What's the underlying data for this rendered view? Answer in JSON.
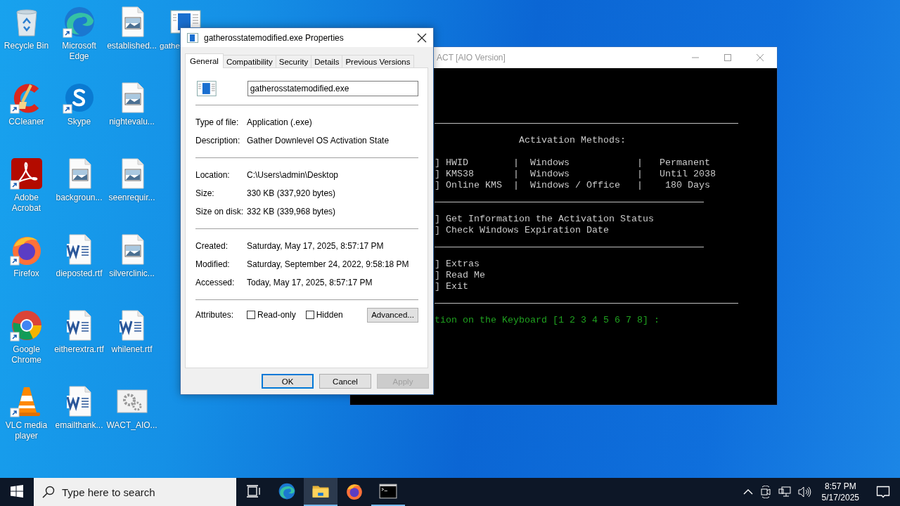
{
  "desktop": {
    "icons": [
      {
        "label": "Recycle Bin",
        "kind": "recycle",
        "shortcut": false
      },
      {
        "label": "CCleaner",
        "kind": "ccleaner",
        "shortcut": true
      },
      {
        "label": "Adobe Acrobat",
        "kind": "acrobat",
        "shortcut": true
      },
      {
        "label": "Firefox",
        "kind": "firefox",
        "shortcut": true
      },
      {
        "label": "Google Chrome",
        "kind": "chrome",
        "shortcut": true
      },
      {
        "label": "VLC media player",
        "kind": "vlc",
        "shortcut": true
      },
      {
        "label": "Microsoft Edge",
        "kind": "edge",
        "shortcut": true
      },
      {
        "label": "Skype",
        "kind": "skype",
        "shortcut": true
      },
      {
        "label": "backgroun...",
        "kind": "image",
        "shortcut": false
      },
      {
        "label": "dieposted.rtf",
        "kind": "word",
        "shortcut": false
      },
      {
        "label": "eitherextra.rtf",
        "kind": "word",
        "shortcut": false
      },
      {
        "label": "emailthank...",
        "kind": "word",
        "shortcut": false
      },
      {
        "label": "established...",
        "kind": "image",
        "shortcut": false
      },
      {
        "label": "nightevalu...",
        "kind": "image",
        "shortcut": false
      },
      {
        "label": "seenrequir...",
        "kind": "image",
        "shortcut": false
      },
      {
        "label": "silverclinic...",
        "kind": "image",
        "shortcut": false
      },
      {
        "label": "whilenet.rtf",
        "kind": "word",
        "shortcut": false
      },
      {
        "label": "WACT_AIO...",
        "kind": "gears",
        "shortcut": false
      },
      {
        "label": "gathe",
        "kind": "exe",
        "shortcut": false
      }
    ]
  },
  "console": {
    "title": "ACT [AIO Version]",
    "lines": [
      {
        "kind": "rule"
      },
      {
        "kind": "heading",
        "text": "Activation Methods:"
      },
      {
        "kind": "blank"
      },
      {
        "kind": "text",
        "text": "] HWID        |  Windows            |   Permanent"
      },
      {
        "kind": "text",
        "text": "] KMS38       |  Windows            |   Until 2038"
      },
      {
        "kind": "text",
        "text": "] Online KMS  |  Windows / Office   |    180 Days"
      },
      {
        "kind": "shortrule"
      },
      {
        "kind": "text",
        "text": "] Get Information the Activation Status"
      },
      {
        "kind": "text",
        "text": "] Check Windows Expiration Date"
      },
      {
        "kind": "shortrule"
      },
      {
        "kind": "text",
        "text": "] Extras"
      },
      {
        "kind": "text",
        "text": "] Read Me"
      },
      {
        "kind": "text",
        "text": "] Exit"
      },
      {
        "kind": "rule"
      },
      {
        "kind": "prompt",
        "text": "tion on the Keyboard [1 2 3 4 5 6 7 8] :"
      }
    ]
  },
  "dialog": {
    "title": "gatherosstatemodified.exe Properties",
    "tabs": [
      {
        "label": "General",
        "selected": true
      },
      {
        "label": "Compatibility",
        "selected": false
      },
      {
        "label": "Security",
        "selected": false
      },
      {
        "label": "Details",
        "selected": false
      },
      {
        "label": "Previous Versions",
        "selected": false
      }
    ],
    "file_name": "gatherosstatemodified.exe",
    "sections": [
      [
        {
          "label": "Type of file:",
          "value": "Application (.exe)"
        },
        {
          "label": "Description:",
          "value": "Gather Downlevel OS Activation State"
        }
      ],
      [
        {
          "label": "Location:",
          "value": "C:\\Users\\admin\\Desktop"
        },
        {
          "label": "Size:",
          "value": "330 KB (337,920 bytes)"
        },
        {
          "label": "Size on disk:",
          "value": "332 KB (339,968 bytes)"
        }
      ],
      [
        {
          "label": "Created:",
          "value": "Saturday, May 17, 2025, 8:57:17 PM"
        },
        {
          "label": "Modified:",
          "value": "Saturday, September 24, 2022, 9:58:18 PM"
        },
        {
          "label": "Accessed:",
          "value": "Today, May 17, 2025, 8:57:17 PM"
        }
      ]
    ],
    "attributes": {
      "label": "Attributes:",
      "checkboxes": [
        {
          "label": "Read-only",
          "checked": false
        },
        {
          "label": "Hidden",
          "checked": false
        }
      ],
      "advanced": "Advanced..."
    },
    "buttons": [
      {
        "label": "OK",
        "default": true,
        "disabled": false
      },
      {
        "label": "Cancel",
        "default": false,
        "disabled": false
      },
      {
        "label": "Apply",
        "default": false,
        "disabled": true
      }
    ]
  },
  "taskbar": {
    "search": {
      "placeholder": "Type here to search"
    },
    "apps": [
      {
        "kind": "taskview",
        "selected": false,
        "running": false
      },
      {
        "kind": "edge",
        "selected": false,
        "running": false
      },
      {
        "kind": "folder",
        "selected": true,
        "running": true
      },
      {
        "kind": "firefox",
        "selected": false,
        "running": false
      },
      {
        "kind": "terminal",
        "selected": false,
        "running": true
      }
    ],
    "clock": {
      "time": "8:57 PM",
      "date": "5/17/2025"
    }
  }
}
